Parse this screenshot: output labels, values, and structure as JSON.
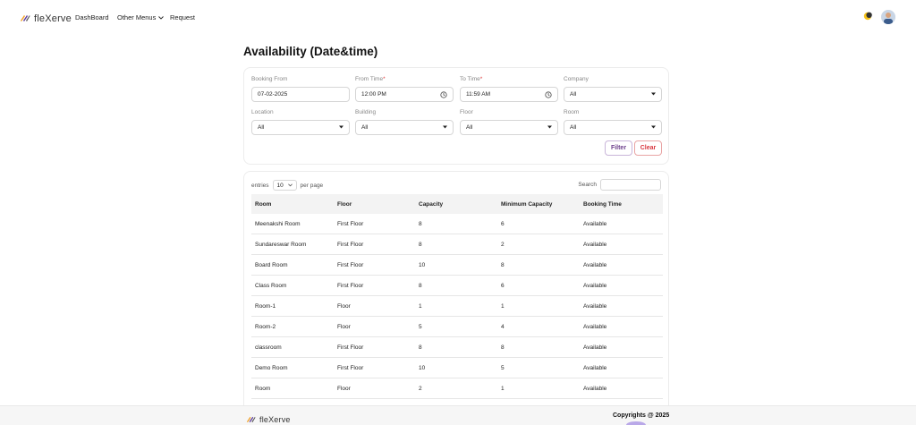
{
  "app": {
    "brand": "fleXerve"
  },
  "nav": {
    "dashboard": "DashBoard",
    "other_menus": "Other Menus",
    "request": "Request"
  },
  "page": {
    "title": "Availability (Date&time)"
  },
  "filters": {
    "booking_from": {
      "label": "Booking From",
      "value": "07-02-2025"
    },
    "from_time": {
      "label": "From Time",
      "required": "*",
      "value": "12:00 PM"
    },
    "to_time": {
      "label": "To Time",
      "required": "*",
      "value": "11:59 AM"
    },
    "company": {
      "label": "Company",
      "value": "All"
    },
    "location": {
      "label": "Location",
      "value": "All"
    },
    "building": {
      "label": "Building",
      "value": "All"
    },
    "floor": {
      "label": "Floor",
      "value": "All"
    },
    "room": {
      "label": "Room",
      "value": "All"
    },
    "filter_button": "Filter",
    "clear_button": "Clear"
  },
  "table": {
    "entries_label": "entries",
    "entries_value": "10",
    "per_page_label": "per page",
    "search_label": "Search",
    "columns": [
      "Room",
      "Floor",
      "Capacity",
      "Minimum Capacity",
      "Booking Time"
    ],
    "rows": [
      [
        "Meenakshi Room",
        "First Floor",
        "8",
        "6",
        "Available"
      ],
      [
        "Sundareswar Room",
        "First Floor",
        "8",
        "2",
        "Available"
      ],
      [
        "Board Room",
        "First Floor",
        "10",
        "8",
        "Available"
      ],
      [
        "Class Room",
        "First Floor",
        "8",
        "6",
        "Available"
      ],
      [
        "Room-1",
        "Floor",
        "1",
        "1",
        "Available"
      ],
      [
        "Room-2",
        "Floor",
        "5",
        "4",
        "Available"
      ],
      [
        "classroom",
        "First Floor",
        "8",
        "8",
        "Available"
      ],
      [
        "Demo Room",
        "First Floor",
        "10",
        "5",
        "Available"
      ],
      [
        "Room",
        "Floor",
        "2",
        "1",
        "Available"
      ]
    ]
  },
  "footer": {
    "brand": "fleXerve",
    "copyright": "Copyrights @ 2025"
  },
  "colors": {
    "accent": "#6d3f8c",
    "danger": "#d9363e",
    "brand_orange": "#f0a023",
    "brand_purple": "#5b3a9c"
  },
  "icons": {
    "logo": "flexerve-logo-icon",
    "chevron": "chevron-down-icon",
    "theme": "sun-moon-icon",
    "clock": "clock-icon",
    "caret": "caret-down-icon"
  }
}
